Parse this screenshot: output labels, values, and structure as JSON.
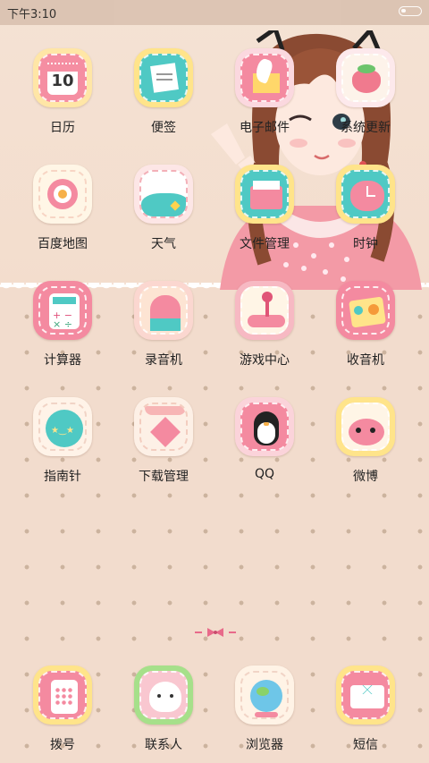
{
  "status_bar": {
    "time": "下午3:10"
  },
  "apps": [
    {
      "label": "日历",
      "icon": "calendar-icon"
    },
    {
      "label": "便签",
      "icon": "notes-icon"
    },
    {
      "label": "电子邮件",
      "icon": "email-icon"
    },
    {
      "label": "系统更新",
      "icon": "strawberry-update-icon"
    },
    {
      "label": "百度地图",
      "icon": "map-target-icon"
    },
    {
      "label": "天气",
      "icon": "weather-icon"
    },
    {
      "label": "文件管理",
      "icon": "file-manager-icon"
    },
    {
      "label": "时钟",
      "icon": "clock-icon"
    },
    {
      "label": "计算器",
      "icon": "calculator-icon"
    },
    {
      "label": "录音机",
      "icon": "recorder-icon"
    },
    {
      "label": "游戏中心",
      "icon": "game-center-icon"
    },
    {
      "label": "收音机",
      "icon": "radio-icon"
    },
    {
      "label": "指南针",
      "icon": "compass-icon"
    },
    {
      "label": "下载管理",
      "icon": "download-manager-icon"
    },
    {
      "label": "QQ",
      "icon": "qq-penguin-icon"
    },
    {
      "label": "微博",
      "icon": "weibo-icon"
    }
  ],
  "dock": [
    {
      "label": "拨号",
      "icon": "phone-icon"
    },
    {
      "label": "联系人",
      "icon": "contacts-icon"
    },
    {
      "label": "浏览器",
      "icon": "browser-globe-icon"
    },
    {
      "label": "短信",
      "icon": "sms-icon"
    }
  ],
  "calendar_day": "10",
  "colors": {
    "accent_pink": "#f48aa0",
    "teal": "#4fc9c4",
    "cream": "#fff4d8",
    "background": "#f2dccd"
  }
}
